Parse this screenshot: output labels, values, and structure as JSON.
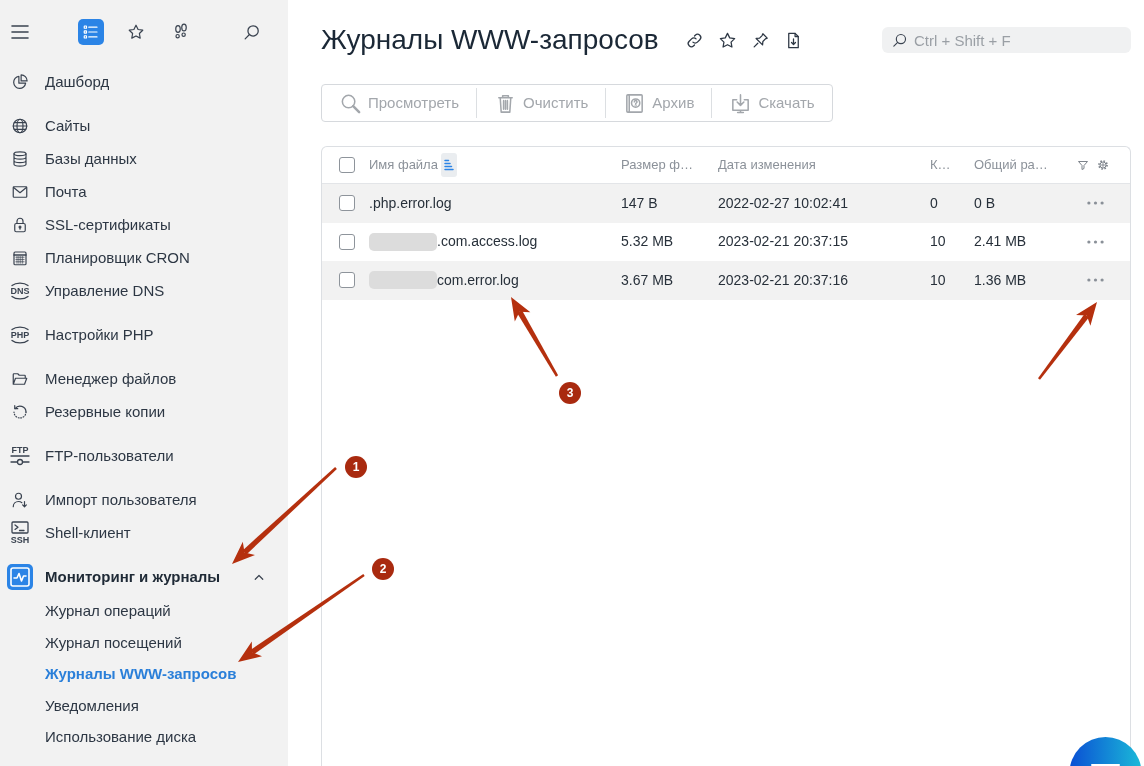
{
  "sidebar": {
    "top_buttons": [
      {
        "selected": true
      },
      {
        "selected": false
      },
      {
        "selected": false
      }
    ],
    "groups": [
      [
        {
          "label": "Дашборд",
          "selected": false
        }
      ],
      [
        {
          "label": "Сайты",
          "selected": false
        },
        {
          "label": "Базы данных",
          "selected": false
        },
        {
          "label": "Почта",
          "selected": false
        },
        {
          "label": "SSL-сертификаты",
          "selected": false
        },
        {
          "label": "Планировщик CRON",
          "selected": false
        },
        {
          "label": "Управление DNS",
          "icon_text": "DNS",
          "selected": false
        }
      ],
      [
        {
          "label": "Настройки PHP",
          "icon_text": "PHP",
          "selected": false
        }
      ],
      [
        {
          "label": "Менеджер файлов",
          "selected": false
        },
        {
          "label": "Резервные копии",
          "selected": false
        }
      ],
      [
        {
          "label": "FTP-пользователи",
          "icon_text": "FTP",
          "selected": false
        }
      ],
      [
        {
          "label": "Импорт пользователя",
          "selected": false
        },
        {
          "label": "Shell-клиент",
          "icon_text": "SSH",
          "selected": false
        }
      ],
      [
        {
          "label": "Мониторинг и журналы",
          "selected": true,
          "expanded": true,
          "children": [
            {
              "label": "Журнал операций",
              "selected": false
            },
            {
              "label": "Журнал посещений",
              "selected": false
            },
            {
              "label": "Журналы WWW-запросов",
              "selected": true
            },
            {
              "label": "Уведомления",
              "selected": false
            },
            {
              "label": "Использование диска",
              "selected": false
            }
          ]
        }
      ]
    ]
  },
  "page": {
    "title": "Журналы WWW-запросов",
    "search": {
      "placeholder": "Ctrl + Shift + F"
    }
  },
  "toolbar": [
    {
      "label": "Просмотреть",
      "disabled": true
    },
    {
      "label": "Очистить",
      "disabled": true
    },
    {
      "label": "Архив",
      "disabled": true
    },
    {
      "label": "Скачать",
      "disabled": true
    }
  ],
  "table": {
    "select_all": {
      "checked": false
    },
    "columns": [
      {
        "label": "Имя файла",
        "sorted": true
      },
      {
        "label": "Размер ф…",
        "sorted": false
      },
      {
        "label": "Дата изменения",
        "sorted": false
      },
      {
        "label": "К…",
        "sorted": false
      },
      {
        "label": "Общий ра…",
        "sorted": false
      }
    ],
    "rows": [
      {
        "checked": false,
        "name": ".php.error.log",
        "name_blurred": false,
        "size": "147 B",
        "modified": "2022-02-27 10:02:41",
        "count": "0",
        "total": "0 B"
      },
      {
        "checked": false,
        "name": ".com.access.log",
        "name_blurred": true,
        "size": "5.32 MB",
        "modified": "2023-02-21 20:37:15",
        "count": "10",
        "total": "2.41 MB"
      },
      {
        "checked": false,
        "name": "com.error.log",
        "name_blurred": true,
        "size": "3.67 MB",
        "modified": "2023-02-21 20:37:16",
        "count": "10",
        "total": "1.36 MB"
      }
    ]
  },
  "annotation_badges": [
    "1",
    "2",
    "3"
  ]
}
